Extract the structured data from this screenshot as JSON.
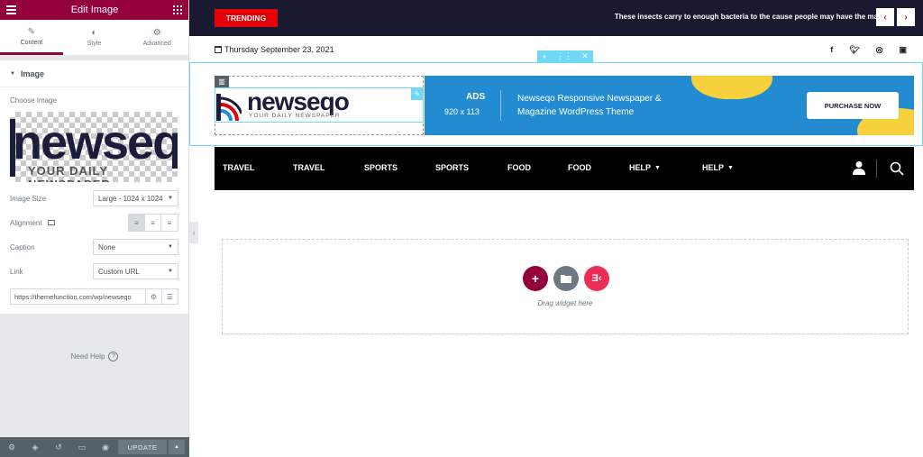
{
  "panel": {
    "title": "Edit Image",
    "tabs": [
      {
        "label": "Content",
        "icon": "pencil-icon"
      },
      {
        "label": "Style",
        "icon": "contrast-icon"
      },
      {
        "label": "Advanced",
        "icon": "gear-icon"
      }
    ],
    "section_title": "Image",
    "choose_image_label": "Choose Image",
    "preview_text": "newseq",
    "preview_tagline": "YOUR DAILY NEWSPAPER",
    "image_size_label": "Image Size",
    "image_size_value": "Large - 1024 x 1024",
    "alignment_label": "Alignment",
    "caption_label": "Caption",
    "caption_value": "None",
    "link_label": "Link",
    "link_value": "Custom URL",
    "url_value": "https://themefunction.com/wp/newseqo",
    "need_help": "Need Help",
    "update_label": "UPDATE"
  },
  "site": {
    "trending_label": "TRENDING",
    "ticker_text": "These insects carry to enough bacteria to the cause people may have the ma",
    "date": "Thursday September 23, 2021",
    "socials": [
      "f",
      "t",
      "ig",
      "in"
    ],
    "logo_text": "newseqo",
    "logo_tagline": "YOUR DAILY NEWSPAPER",
    "banner": {
      "ads": "ADS",
      "size": "920 x 113",
      "desc": "Newseqo Responsive Newspaper & Magazine WordPress Theme",
      "cta": "PURCHASE NOW"
    },
    "nav": [
      {
        "label": "TRAVEL",
        "dropdown": false
      },
      {
        "label": "TRAVEL",
        "dropdown": false
      },
      {
        "label": "SPORTS",
        "dropdown": false
      },
      {
        "label": "SPORTS",
        "dropdown": false
      },
      {
        "label": "FOOD",
        "dropdown": false
      },
      {
        "label": "FOOD",
        "dropdown": false
      },
      {
        "label": "HELP",
        "dropdown": true
      },
      {
        "label": "HELP",
        "dropdown": true
      }
    ],
    "drop_text": "Drag widget here"
  },
  "colors": {
    "editor_header": "#93003c",
    "topbar": "#191a30",
    "trending": "#e30007",
    "banner": "#228bd2",
    "accent_yellow": "#f6d13d",
    "handle": "#71d7f7"
  }
}
